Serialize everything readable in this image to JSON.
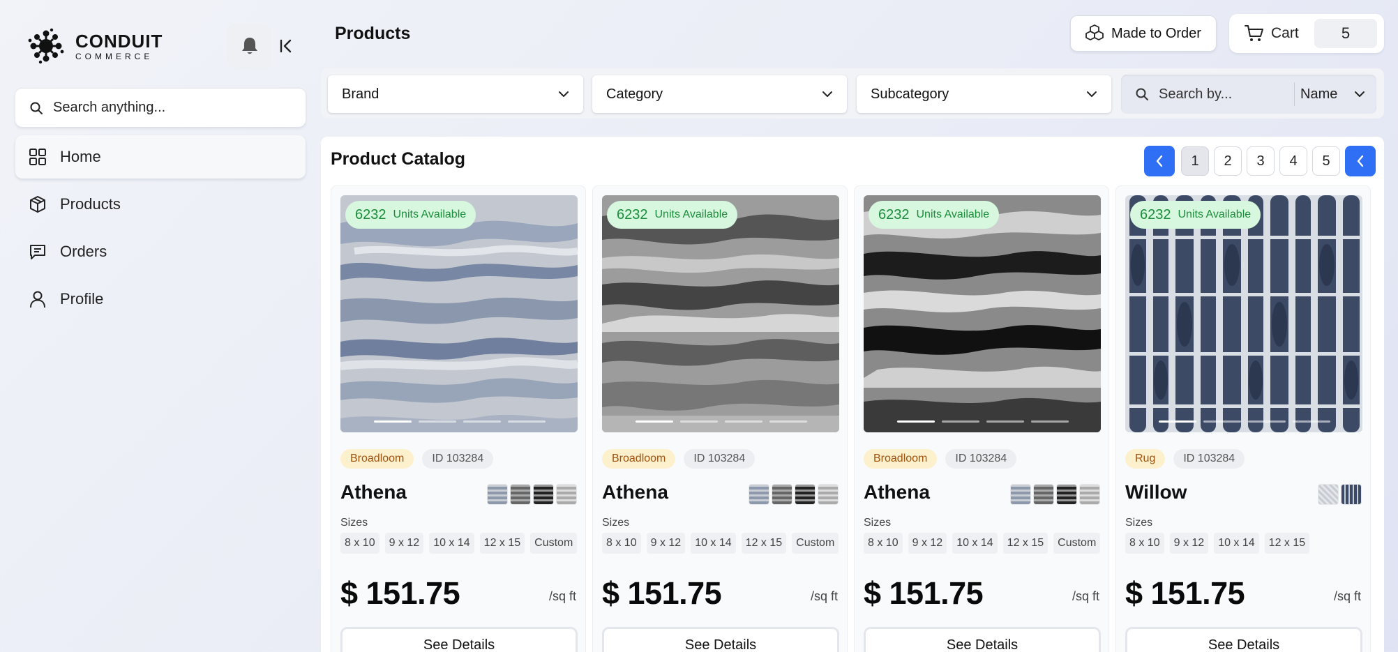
{
  "brand": {
    "line1": "CONDUIT",
    "line2": "COMMERCE"
  },
  "sidebar": {
    "search_placeholder": "Search anything...",
    "items": [
      {
        "label": "Home",
        "icon": "grid-icon",
        "active": true
      },
      {
        "label": "Products",
        "icon": "box-icon",
        "active": false
      },
      {
        "label": "Orders",
        "icon": "message-icon",
        "active": false
      },
      {
        "label": "Profile",
        "icon": "user-icon",
        "active": false
      }
    ]
  },
  "header": {
    "title": "Products",
    "made_to_order": "Made to Order",
    "cart_label": "Cart",
    "cart_count": "5"
  },
  "filters": {
    "brand": "Brand",
    "category": "Category",
    "subcategory": "Subcategory",
    "search_placeholder": "Search by...",
    "search_field": "Name"
  },
  "catalog": {
    "title": "Product Catalog",
    "pages": [
      "1",
      "2",
      "3",
      "4",
      "5"
    ],
    "current_page": "1",
    "sizes_label": "Sizes",
    "units_label": "Units Available",
    "details_label": "See Details",
    "products": [
      {
        "stock": "6232",
        "type": "Broadloom",
        "id": "ID 103284",
        "name": "Athena",
        "sizes": [
          "8 x 10",
          "9 x 12",
          "10 x 14",
          "12 x 15",
          "Custom"
        ],
        "price": "$ 151.75",
        "unit": "/sq ft",
        "swatch_count": 4
      },
      {
        "stock": "6232",
        "type": "Broadloom",
        "id": "ID 103284",
        "name": "Athena",
        "sizes": [
          "8 x 10",
          "9 x 12",
          "10 x 14",
          "12 x 15",
          "Custom"
        ],
        "price": "$ 151.75",
        "unit": "/sq ft",
        "swatch_count": 4
      },
      {
        "stock": "6232",
        "type": "Broadloom",
        "id": "ID 103284",
        "name": "Athena",
        "sizes": [
          "8 x 10",
          "9 x 12",
          "10 x 14",
          "12 x 15",
          "Custom"
        ],
        "price": "$ 151.75",
        "unit": "/sq ft",
        "swatch_count": 4
      },
      {
        "stock": "6232",
        "type": "Rug",
        "id": "ID 103284",
        "name": "Willow",
        "sizes": [
          "8 x 10",
          "9 x 12",
          "10 x 14",
          "12 x 15"
        ],
        "price": "$ 151.75",
        "unit": "/sq ft",
        "swatch_count": 2
      }
    ]
  },
  "colors": {
    "accent": "#2f6ff5",
    "stock_bg": "#d7f7de",
    "stock_text": "#1a8d3a",
    "type_bg": "#fdf0cc",
    "type_text": "#a1520d"
  }
}
